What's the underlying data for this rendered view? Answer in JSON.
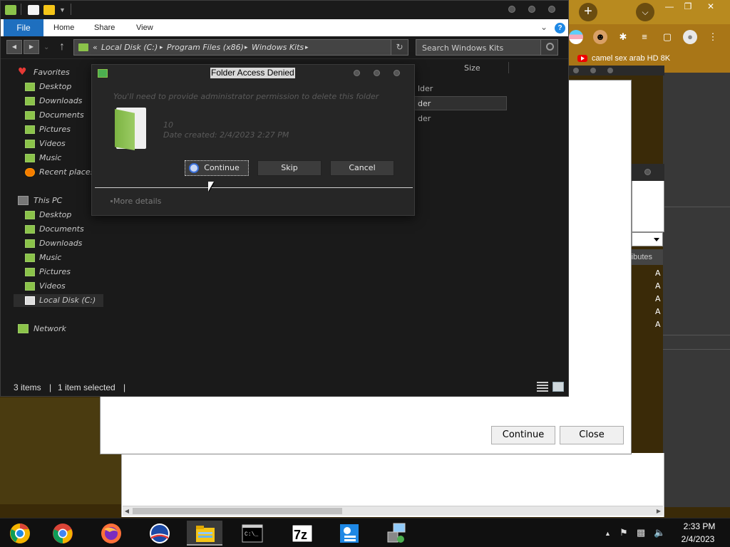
{
  "browser": {
    "new_tab_symbol": "+",
    "bookmark_label": "camel sex arab HD 8K"
  },
  "explorer": {
    "ribbon_tabs": [
      "File",
      "Home",
      "Share",
      "View"
    ],
    "help_symbol": "?",
    "address": {
      "prefix": "«",
      "segments": [
        "Local Disk (C:)",
        "Program Files (x86)",
        "Windows Kits"
      ],
      "separator": "▸"
    },
    "search_placeholder": "Search Windows Kits",
    "nav": {
      "favorites_label": "Favorites",
      "favorites": [
        "Desktop",
        "Downloads",
        "Documents",
        "Pictures",
        "Videos",
        "Music",
        "Recent places"
      ],
      "this_pc_label": "This PC",
      "this_pc": [
        "Desktop",
        "Documents",
        "Downloads",
        "Music",
        "Pictures",
        "Videos",
        "Local Disk (C:)"
      ],
      "network_label": "Network"
    },
    "columns": {
      "size": "Size"
    },
    "files": [
      {
        "type": "lder"
      },
      {
        "type": "der",
        "selected": true
      },
      {
        "type": "der"
      }
    ],
    "status": {
      "items": "3 items",
      "selected": "1 item selected"
    }
  },
  "dialog": {
    "title": "Folder Access Denied",
    "message": "You'll need to provide administrator permission to delete this folder",
    "folder_name": "10",
    "date_created": "Date created: 2/4/2023 2:27 PM",
    "buttons": {
      "continue": "Continue",
      "skip": "Skip",
      "cancel": "Cancel"
    },
    "more_details": "More details"
  },
  "background_window": {
    "buttons": {
      "continue": "Continue",
      "close": "Close"
    },
    "header_fragment": "ributes",
    "rows": [
      "A",
      "A",
      "A",
      "A",
      "A"
    ]
  },
  "taskbar": {
    "apps": [
      "chrome-alt",
      "chrome",
      "firefox",
      "obama-app",
      "file-explorer",
      "cmd",
      "7zip",
      "control-panel",
      "network-manager"
    ],
    "clock_time": "2:33 PM",
    "clock_date": "2/4/2023"
  },
  "colors": {
    "accent_file_tab": "#1e6fbf",
    "folder_green": "#8bc34a",
    "dialog_bg": "#262626",
    "explorer_bg": "#1a1a1a"
  }
}
